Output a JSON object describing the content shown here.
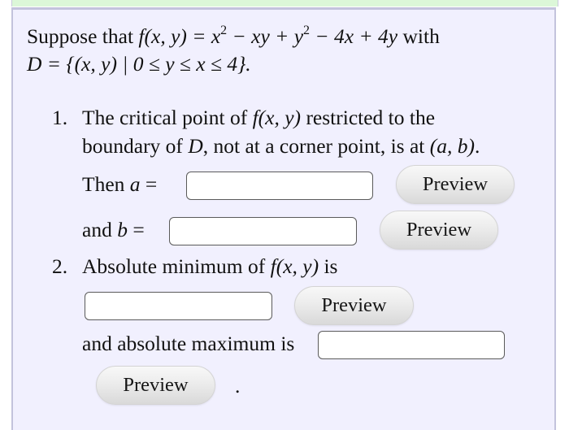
{
  "problem": {
    "intro_text": "Suppose that",
    "function_lhs": "f(x, y) =",
    "function_rhs_parts": [
      "x",
      "2",
      " − xy + y",
      "2",
      " − 4x + 4y"
    ],
    "with_text": "with",
    "domain_line": "D = {(x, y) | 0 ≤ y ≤ x ≤ 4}."
  },
  "items": [
    {
      "number": "1.",
      "line1": [
        "The critical point of ",
        "f(x, y)",
        " restricted to the"
      ],
      "line2": [
        "boundary of ",
        "D",
        ", not at a corner point, is at ",
        "(a, b)",
        "."
      ],
      "fields": [
        {
          "label_prefix": "Then ",
          "var": "a",
          "eq": " =",
          "value": "",
          "placeholder": "",
          "button": "Preview"
        },
        {
          "label_prefix": "and ",
          "var": "b",
          "eq": " =",
          "value": "",
          "placeholder": "",
          "button": "Preview"
        }
      ]
    },
    {
      "number": "2.",
      "line1": [
        "Absolute minimum of ",
        "f(x, y)",
        " is"
      ],
      "min_field": {
        "value": "",
        "placeholder": "",
        "button": "Preview"
      },
      "max_label": "and absolute maximum is",
      "max_field": {
        "value": "",
        "placeholder": "",
        "button": "Preview"
      },
      "trailing": "."
    }
  ],
  "colors": {
    "panel_bg": "#f1f0fe",
    "panel_border": "#c3c3dc",
    "top_band": "#dcf7d8"
  }
}
